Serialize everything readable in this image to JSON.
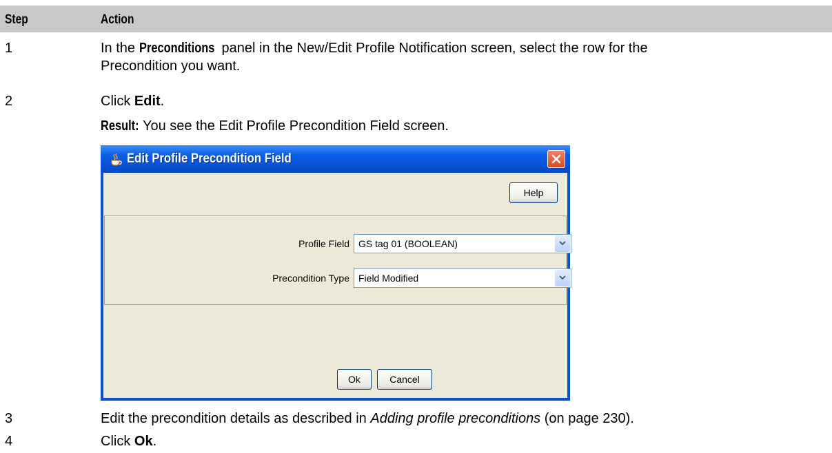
{
  "header": {
    "step": "Step",
    "action": "Action"
  },
  "steps": [
    {
      "num": "1",
      "pre": "In the ",
      "bold": "Preconditions",
      "post": " panel in the New/Edit Profile Notification screen, select the row for the",
      "line2": "Precondition you want."
    },
    {
      "num": "2",
      "pre": "Click ",
      "bold": "Edit",
      "post": "."
    },
    {
      "num": "3",
      "pre": "Edit the precondition details as described in ",
      "italic": "Adding profile preconditions",
      "post": " (on page 230)."
    },
    {
      "num": "4",
      "pre": "Click ",
      "bold": "Ok",
      "post": "."
    }
  ],
  "result": {
    "label": "Result:",
    "text": " You see the Edit Profile Precondition Field screen."
  },
  "dialog": {
    "title": "Edit Profile Precondition Field",
    "help_label": "Help",
    "profile_field_label": "Profile Field",
    "profile_field_value": "GS tag 01 (BOOLEAN)",
    "precondition_type_label": "Precondition Type",
    "precondition_type_value": "Field Modified",
    "ok_label": "Ok",
    "cancel_label": "Cancel"
  },
  "colors": {
    "header_bg": "#c9c9c9",
    "title_bar": "#0a52d6",
    "dialog_bg": "#ece9d8"
  }
}
